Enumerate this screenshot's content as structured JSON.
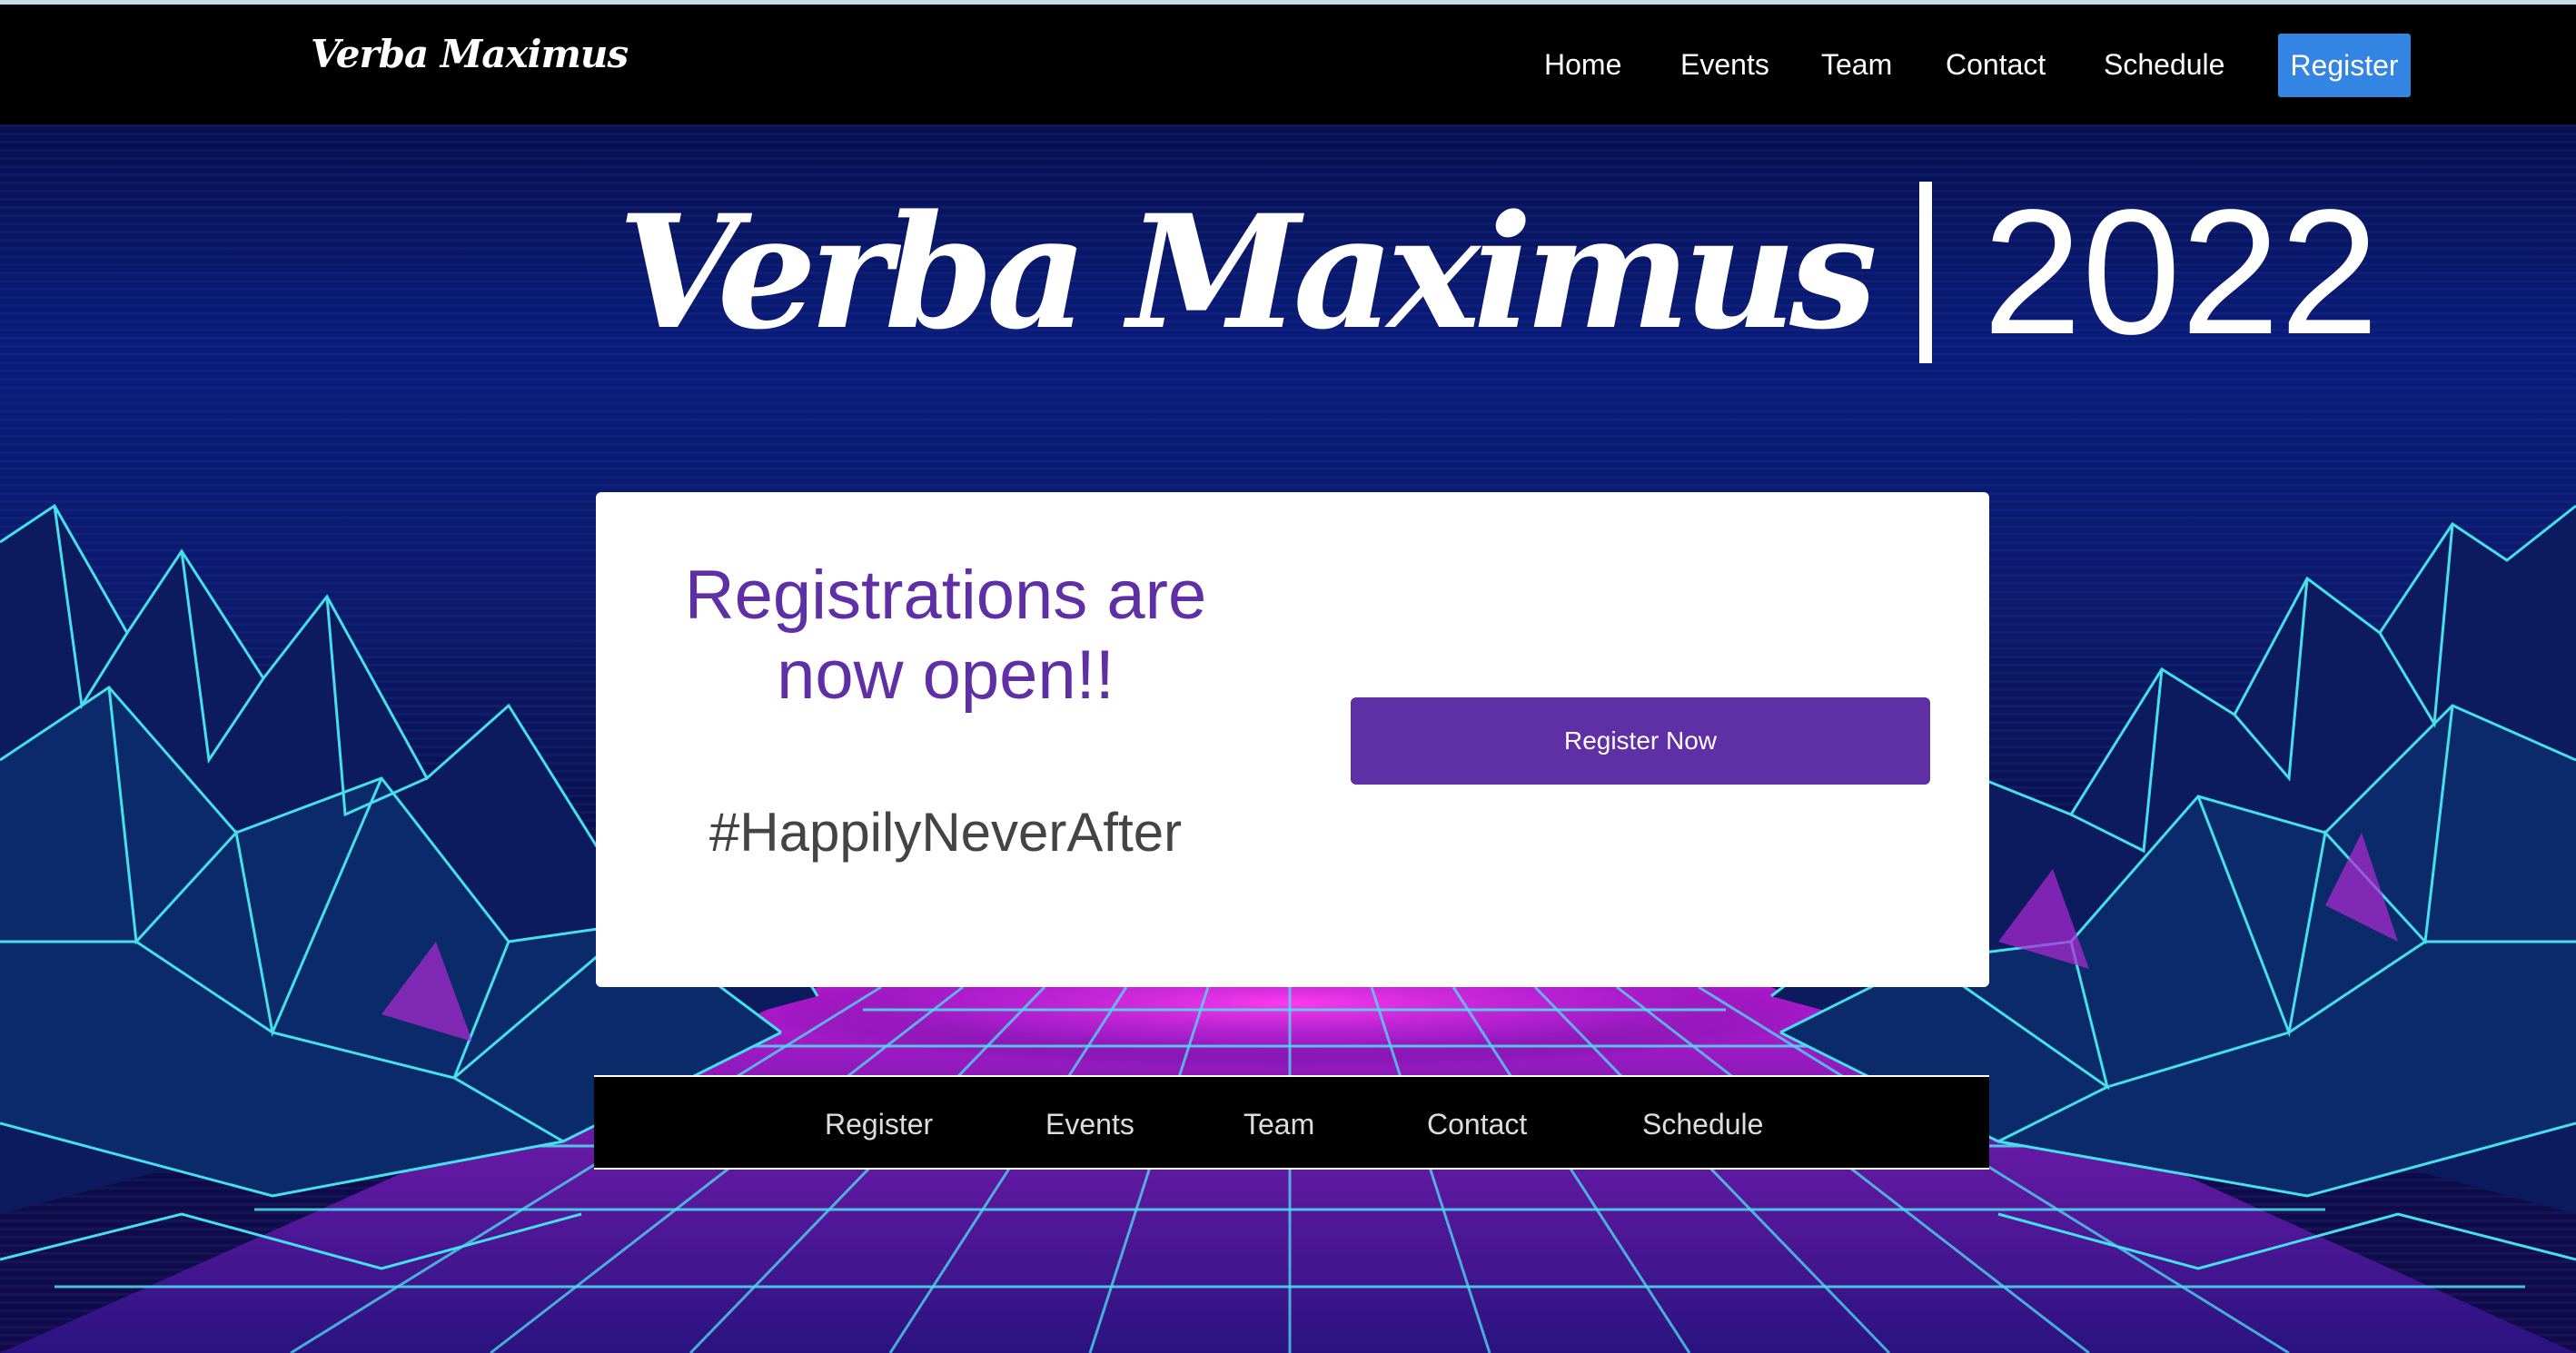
{
  "navbar": {
    "brand": "Verba Maximus",
    "links": [
      "Home",
      "Events",
      "Team",
      "Contact",
      "Schedule"
    ],
    "register_label": "Register"
  },
  "hero": {
    "script_title": "Verba Maximus",
    "year": "2022"
  },
  "card": {
    "heading_line1": "Registrations are",
    "heading_line2": "now open!!",
    "hashtag": "#HappilyNeverAfter",
    "button_label": "Register Now"
  },
  "subnav": {
    "links": [
      "Register",
      "Events",
      "Team",
      "Contact",
      "Schedule"
    ]
  },
  "colors": {
    "accent_purple": "#5f2fa5",
    "register_blue": "#3384e3",
    "grid_cyan": "#3fd6e0",
    "grid_magenta": "#e02ce0"
  }
}
